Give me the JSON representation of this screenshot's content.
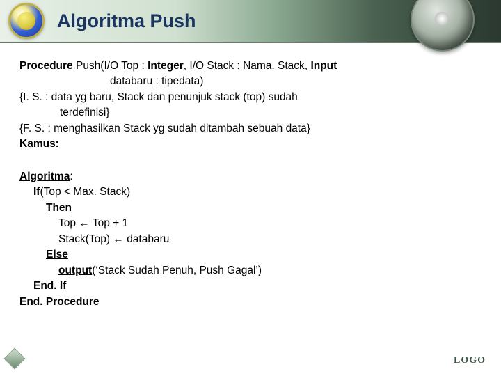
{
  "title": "Algoritma Push",
  "proc": {
    "kw_procedure": "Procedure",
    "name": " Push(",
    "p1a": "I/O",
    "p1b": " Top : ",
    "p1c": "Integer",
    "p1d": ", ",
    "p2a": "I/O",
    "p2b": " Stack : ",
    "p2c": "Nama. Stack",
    "p2d": ", ",
    "p3a": "Input",
    "line2": "databaru : tipedata)",
    "is": "{I. S. : data yg baru, Stack dan penunjuk stack (top) sudah",
    "is2": "terdefinisi}",
    "fs": "{F. S. : menghasilkan Stack yg sudah ditambah sebuah data}",
    "kamus": "Kamus:"
  },
  "algo": {
    "head": "Algoritma",
    "colon": ":",
    "if": "If",
    "cond": "(Top < Max. Stack)",
    "then": "Then",
    "s1": "Top ← Top + 1",
    "s2": "Stack(Top)  ←  databaru",
    "else": "Else",
    "out": "output",
    "outarg": "(‘Stack Sudah Penuh, Push Gagal’)",
    "endif": "End. If",
    "endproc": "End. Procedure"
  },
  "footer": {
    "logo": "LOGO"
  }
}
